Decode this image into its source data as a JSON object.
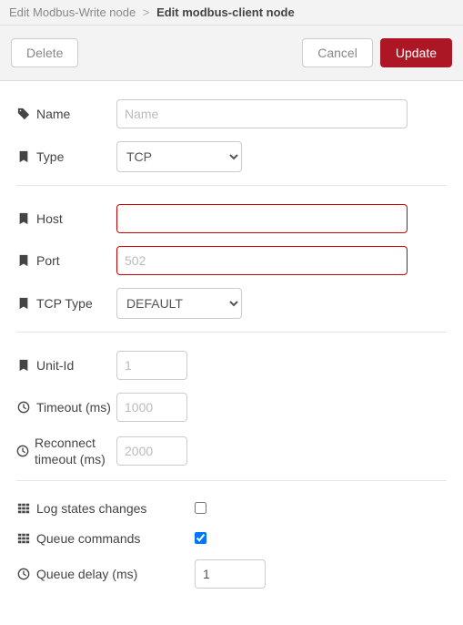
{
  "breadcrumb": {
    "parent": "Edit Modbus-Write node",
    "separator": ">",
    "current": "Edit modbus-client node"
  },
  "buttons": {
    "delete": "Delete",
    "cancel": "Cancel",
    "update": "Update"
  },
  "fields": {
    "name": {
      "label": "Name",
      "placeholder": "Name",
      "value": ""
    },
    "type": {
      "label": "Type",
      "value": "TCP"
    },
    "host": {
      "label": "Host",
      "value": ""
    },
    "port": {
      "label": "Port",
      "placeholder": "502",
      "value": ""
    },
    "tcptype": {
      "label": "TCP Type",
      "value": "DEFAULT"
    },
    "unitid": {
      "label": "Unit-Id",
      "placeholder": "1",
      "value": ""
    },
    "timeout": {
      "label": "Timeout (ms)",
      "placeholder": "1000",
      "value": ""
    },
    "reconnect": {
      "label": "Reconnect timeout (ms)",
      "placeholder": "2000",
      "value": ""
    },
    "logstates": {
      "label": "Log states changes",
      "checked": false
    },
    "queuecmds": {
      "label": "Queue commands",
      "checked": true
    },
    "queuedelay": {
      "label": "Queue delay (ms)",
      "value": "1"
    }
  }
}
